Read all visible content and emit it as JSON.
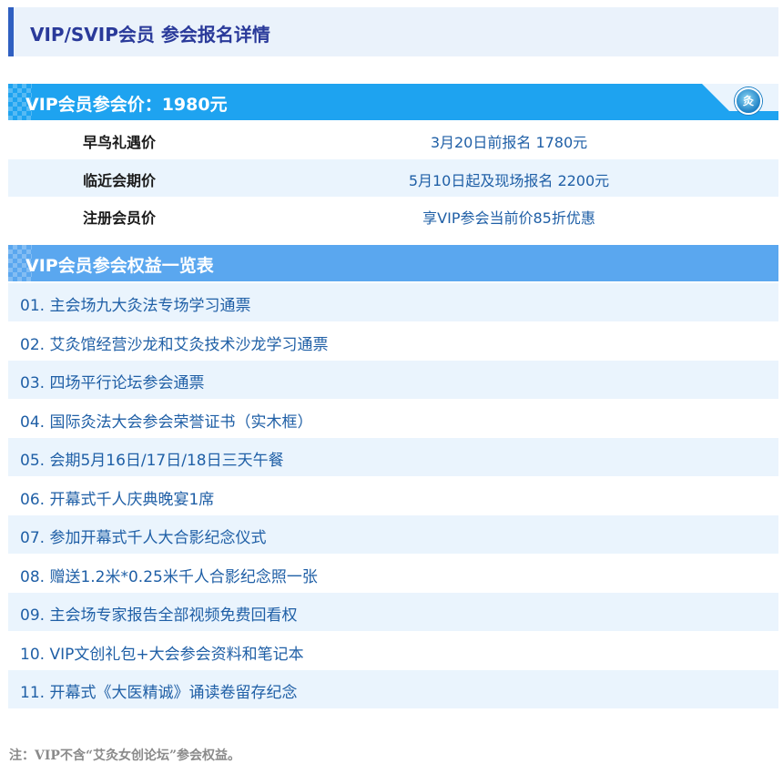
{
  "title": "VIP/SVIP会员  参会报名详情",
  "price_section": {
    "header": "VIP会员参会价：1980元",
    "logo_glyph": "灸",
    "rows": [
      {
        "name": "早鸟礼遇价",
        "detail": "3月20日前报名 1780元"
      },
      {
        "name": "临近会期价",
        "detail": "5月10日起及现场报名 2200元"
      },
      {
        "name": "注册会员价",
        "detail": "享VIP参会当前价85折优惠"
      }
    ]
  },
  "benefits_section": {
    "header": "VIP会员参会权益一览表",
    "items": [
      "01. 主会场九大灸法专场学习通票",
      "02. 艾灸馆经营沙龙和艾灸技术沙龙学习通票",
      "03. 四场平行论坛参会通票",
      "04. 国际灸法大会参会荣誉证书（实木框）",
      "05. 会期5月16日/17日/18日三天午餐",
      "06. 开幕式千人庆典晚宴1席",
      "07. 参加开幕式千人大合影纪念仪式",
      "08. 赠送1.2米*0.25米千人合影纪念照一张",
      "09. 主会场专家报告全部视频免费回看权",
      "10. VIP文创礼包+大会参会资料和笔记本",
      "11. 开幕式《大医精诚》诵读卷留存纪念"
    ]
  },
  "note": "注：VIP不含“艾灸女创论坛”参会权益。",
  "colors": {
    "accent": "#2f5fc1",
    "band_primary": "#1ea3f0",
    "band_secondary": "#5aa7ef",
    "row_shade": "#eaf4fd",
    "text_blue": "#1f5fa6"
  }
}
